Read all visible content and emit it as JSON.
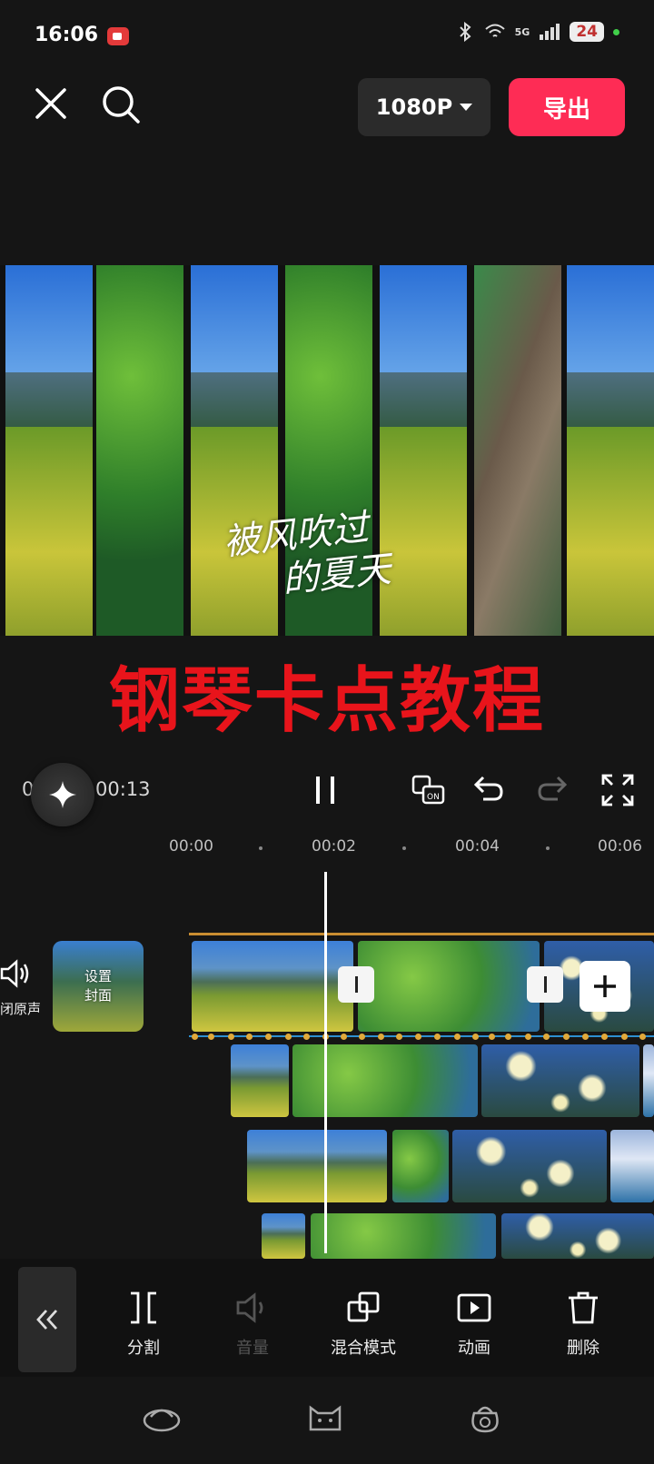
{
  "status_bar": {
    "time": "16:06",
    "network": "5G",
    "battery": "24",
    "icons": [
      "screen-record-icon",
      "bluetooth-icon",
      "wifi-icon",
      "signal-icon",
      "battery-icon"
    ]
  },
  "top_bar": {
    "resolution_label": "1080P",
    "export_label": "导出",
    "export_color": "#fe2c55"
  },
  "preview": {
    "caption_line1": "被风吹过",
    "caption_line2": "的夏天",
    "title_overlay": "钢琴卡点教程",
    "title_color": "#e8141b"
  },
  "playback": {
    "current_time": "00:01",
    "separator": " / ",
    "total_time": "00:13"
  },
  "timeline": {
    "ruler": [
      {
        "label": "00:00"
      },
      {
        "label": "00:02"
      },
      {
        "label": "00:04"
      },
      {
        "label": "00:06"
      }
    ],
    "mute_label": "闭原声",
    "cover_line1": "设置",
    "cover_line2": "封面"
  },
  "toolbar": {
    "items": [
      {
        "label": "分割",
        "enabled": true
      },
      {
        "label": "音量",
        "enabled": false
      },
      {
        "label": "混合模式",
        "enabled": true
      },
      {
        "label": "动画",
        "enabled": true
      },
      {
        "label": "删除",
        "enabled": true
      }
    ]
  }
}
